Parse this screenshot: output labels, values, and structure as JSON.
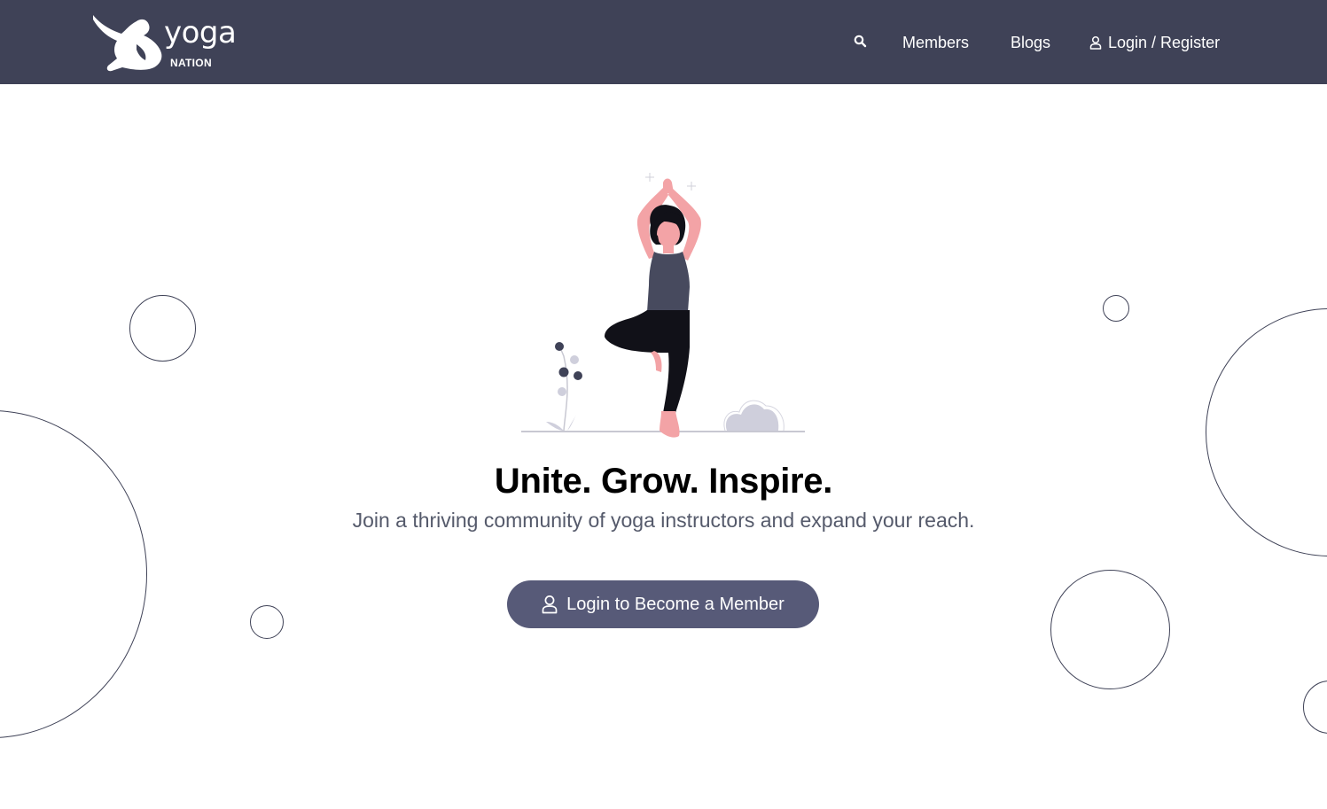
{
  "brand": {
    "name": "yoga",
    "sub": "NATION",
    "logo_icon": "yoga-pose-silhouette-icon"
  },
  "nav": {
    "search_icon": "search-icon",
    "members": "Members",
    "blogs": "Blogs",
    "login_icon": "user-icon",
    "login": "Login / Register"
  },
  "hero": {
    "illustration": "woman-tree-pose-illustration",
    "title": "Unite. Grow. Inspire.",
    "subtitle": "Join a thriving community of yoga instructors and expand your reach.",
    "cta_icon": "user-icon",
    "cta_label": "Login to Become a Member"
  },
  "colors": {
    "header_bg": "#3f4257",
    "button_bg": "#575a78",
    "circle_stroke": "#3f4257",
    "subtitle_text": "#555a6b"
  }
}
